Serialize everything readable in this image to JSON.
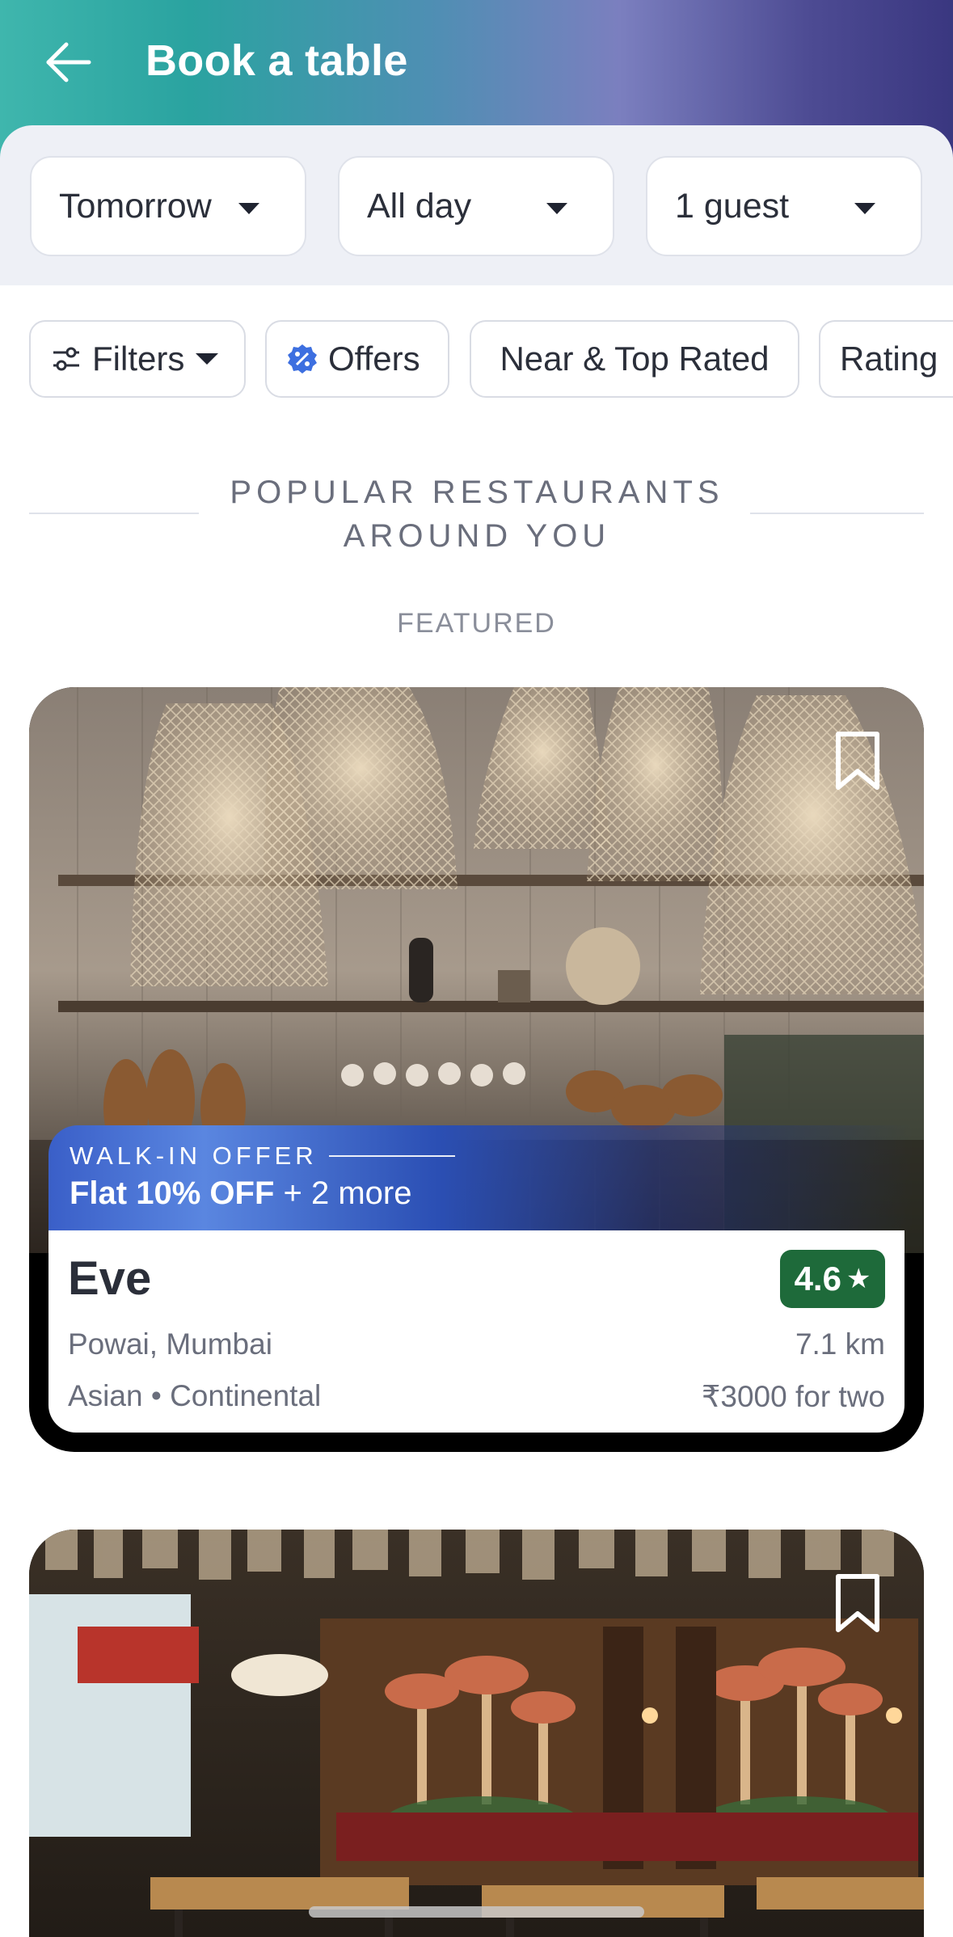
{
  "header": {
    "title": "Book a table"
  },
  "selectors": {
    "date": "Tomorrow",
    "time": "All day",
    "guests": "1 guest"
  },
  "chips": {
    "filters": "Filters",
    "offers": "Offers",
    "near": "Near & Top Rated",
    "rating": "Rating"
  },
  "section": {
    "title_line1": "POPULAR RESTAURANTS",
    "title_line2": "AROUND YOU",
    "featured": "FEATURED"
  },
  "restaurants": [
    {
      "offer_kicker": "WALK-IN OFFER",
      "offer_bold": "Flat 10% OFF",
      "offer_rest": " + 2 more",
      "name": "Eve",
      "rating": "4.6",
      "location": "Powai, Mumbai",
      "distance": "7.1 km",
      "cuisine": "Asian • Continental",
      "price": "₹3000 for two"
    }
  ],
  "colors": {
    "rating_badge": "#1e6a3a",
    "offer_blue": "#3a5fc8",
    "header_start": "#3fb6ad",
    "header_end": "#3a3780"
  }
}
